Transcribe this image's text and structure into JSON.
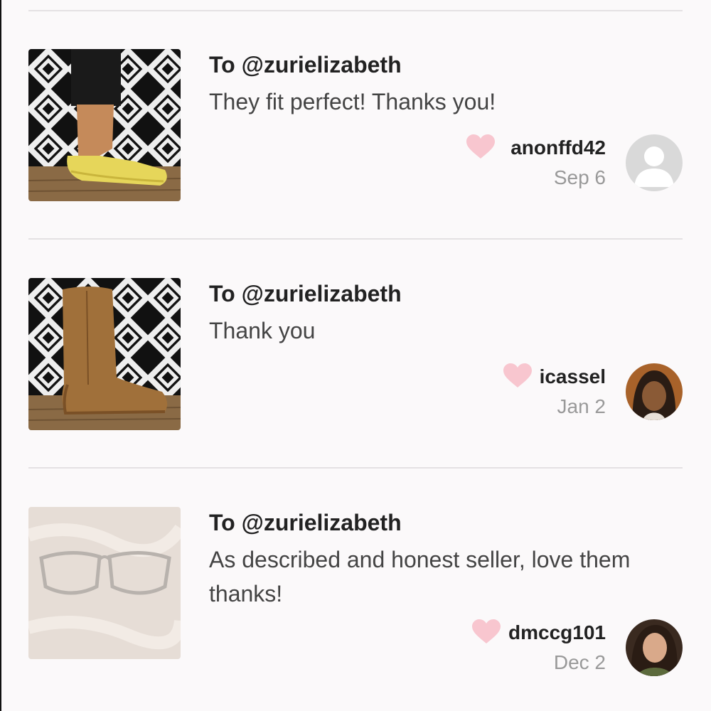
{
  "colors": {
    "heart": "#f8c6cf",
    "divider": "#e4e1e3",
    "background": "#fbf9fa"
  },
  "reviews": [
    {
      "to_label": "To @zurielizabeth",
      "message": "They fit perfect! Thanks you!",
      "username": "anonffd42",
      "date": "Sep 6",
      "thumbnail": "yellow-flat-shoes-photo",
      "avatar": "default-user-avatar",
      "heart_icon": "heart-icon"
    },
    {
      "to_label": "To @zurielizabeth",
      "message": "Thank you",
      "username": "icassel",
      "date": "Jan 2",
      "thumbnail": "tan-boot-photo",
      "avatar": "user-photo-avatar",
      "heart_icon": "heart-icon"
    },
    {
      "to_label": "To @zurielizabeth",
      "message": "As described and honest seller, love them thanks!",
      "username": "dmccg101",
      "date": "Dec 2",
      "thumbnail": "clear-glasses-photo",
      "avatar": "user-photo-avatar",
      "heart_icon": "heart-icon"
    }
  ]
}
